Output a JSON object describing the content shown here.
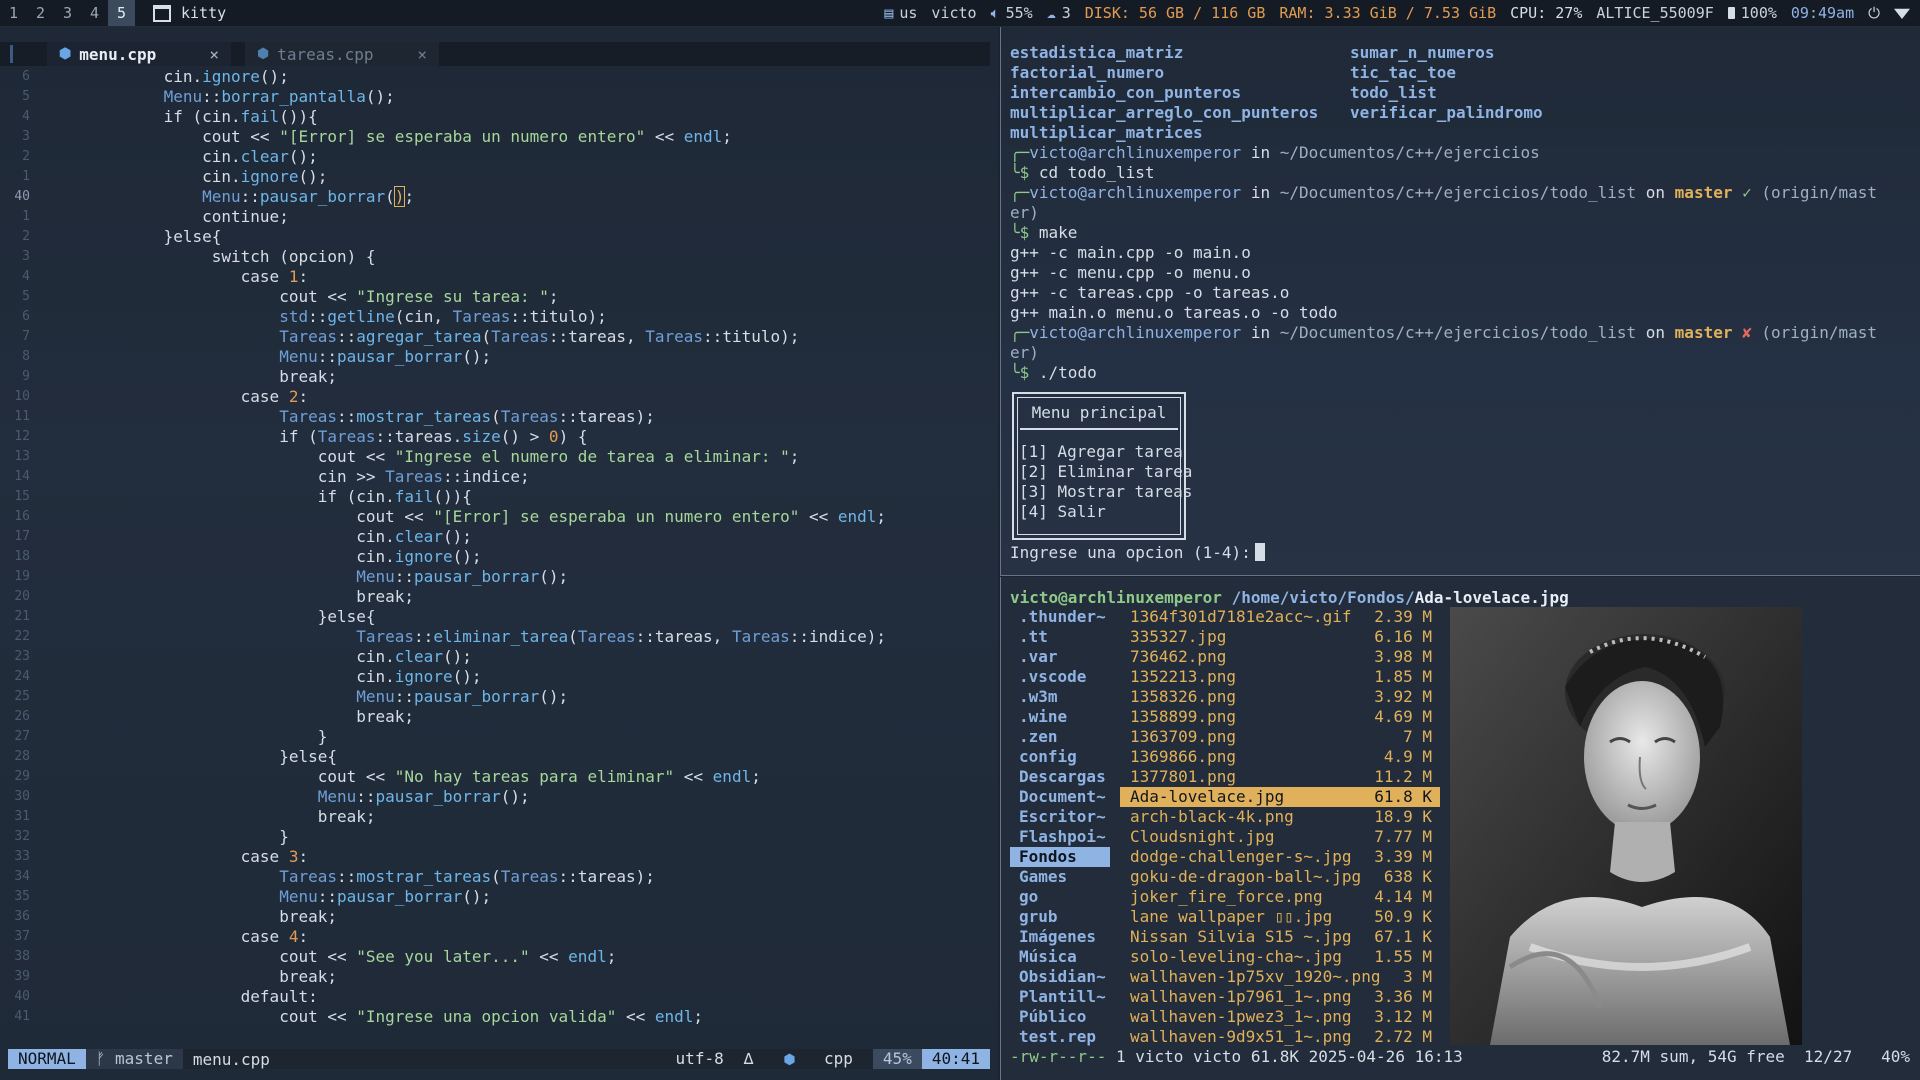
{
  "topbar": {
    "workspaces": [
      "1",
      "2",
      "3",
      "4",
      "5"
    ],
    "active_workspace": "5",
    "window_title": "kitty",
    "keyboard": "us",
    "user": "victo",
    "volume": "55%",
    "updates": "3",
    "disk": "DISK: 56 GB / 116 GB",
    "ram": "RAM: 3.33 GiB / 7.53 GiB",
    "cpu": "CPU: 27%",
    "network": "ALTICE_55009F",
    "battery": "100%",
    "time": "09:49am"
  },
  "editor": {
    "tabs": [
      {
        "label": "menu.cpp",
        "close": "×"
      },
      {
        "label": "tareas.cpp",
        "close": "×"
      }
    ],
    "statusline": {
      "mode": "NORMAL",
      "branch": "master",
      "file": "menu.cpp",
      "encoding": "utf-8",
      "delta": "∆",
      "filetype": "cpp",
      "percent": "45%",
      "position": "40:41"
    },
    "line_numbers": [
      "6",
      "5",
      "4",
      "3",
      "2",
      "1",
      "40",
      "1",
      "2",
      "3",
      "4",
      "5",
      "6",
      "7",
      "8",
      "9",
      "10",
      "11",
      "12",
      "13",
      "14",
      "15",
      "16",
      "17",
      "18",
      "19",
      "20",
      "21",
      "22",
      "23",
      "24",
      "25",
      "26",
      "27",
      "28",
      "29",
      "30",
      "31",
      "32",
      "33",
      "34",
      "35",
      "36",
      "37",
      "38",
      "39",
      "40",
      "41"
    ]
  },
  "terminal": {
    "ls_col1": [
      "estadistica_matriz",
      "factorial_numero",
      "intercambio_con_punteros",
      "multiplicar_arreglo_con_punteros",
      "multiplicar_matrices"
    ],
    "ls_col2": [
      "sumar_n_numeros",
      "tic_tac_toe",
      "todo_list",
      "verificar_palindromo"
    ],
    "prompt1_user": "victo@archlinuxemperor",
    "prompt1_in": " in ",
    "prompt1_path": "~/Documentos/c++/ejercicios",
    "cmd1": "cd todo_list",
    "prompt2_path": "~/Documentos/c++/ejercicios/todo_list",
    "on": " on ",
    "branch": "master",
    "ok_mark": "✓",
    "bad_mark": "✘",
    "origin_a": "(origin/mast",
    "origin_b": "er)",
    "cmd2": "make",
    "make_out": [
      "g++ -c main.cpp -o main.o",
      "g++ -c menu.cpp -o menu.o",
      "g++ -c tareas.cpp -o tareas.o",
      "g++ main.o menu.o tareas.o -o todo"
    ],
    "cmd3": "./todo",
    "menu_title": "Menu principal",
    "menu_items": [
      "[1] Agregar tarea",
      "[2] Eliminar tarea",
      "[3] Mostrar tareas",
      "[4] Salir"
    ],
    "input_prompt": "Ingrese una opcion (1-4):"
  },
  "file_manager": {
    "header_user": "victo@archlinuxemperor",
    "header_path": "/home/victo/Fondos/",
    "header_file": "Ada-lovelace.jpg",
    "dirs": [
      ".thunder~",
      ".tt",
      ".var",
      ".vscode",
      ".w3m",
      ".wine",
      ".zen",
      "config",
      "Descargas",
      "Document~",
      "Escritor~",
      "Flashpoi~",
      "Fondos",
      "Games",
      "go",
      "grub",
      "Imágenes",
      "Música",
      "Obsidian~",
      "Plantill~",
      "Público",
      "test.rep"
    ],
    "selected_dir": "Fondos",
    "files": [
      {
        "name": "1364f301d7181e2acc~.gif",
        "size": "2.39 M"
      },
      {
        "name": "335327.jpg",
        "size": "6.16 M"
      },
      {
        "name": "736462.png",
        "size": "3.98 M"
      },
      {
        "name": "1352213.png",
        "size": "1.85 M"
      },
      {
        "name": "1358326.png",
        "size": "3.92 M"
      },
      {
        "name": "1358899.png",
        "size": "4.69 M"
      },
      {
        "name": "1363709.png",
        "size": "7 M"
      },
      {
        "name": "1369866.png",
        "size": "4.9 M"
      },
      {
        "name": "1377801.png",
        "size": "11.2 M"
      },
      {
        "name": "Ada-lovelace.jpg",
        "size": "61.8 K"
      },
      {
        "name": "arch-black-4k.png",
        "size": "18.9 K"
      },
      {
        "name": "Cloudsnight.jpg",
        "size": "7.77 M"
      },
      {
        "name": "dodge-challenger-s~.jpg",
        "size": "3.39 M"
      },
      {
        "name": "goku-de-dragon-ball~.jpg",
        "size": "638 K"
      },
      {
        "name": "joker_fire_force.png",
        "size": "4.14 M"
      },
      {
        "name": "lane wallpaper ▯▯.jpg",
        "size": "50.9 K"
      },
      {
        "name": "Nissan Silvia S15 ~.jpg",
        "size": "67.1 K"
      },
      {
        "name": "solo-leveling-cha~.jpg",
        "size": "1.55 M"
      },
      {
        "name": "wallhaven-1p75xv_1920~.png",
        "size": "3 M"
      },
      {
        "name": "wallhaven-1p7961_1~.png",
        "size": "3.36 M"
      },
      {
        "name": "wallhaven-1pwez3_1~.png",
        "size": "3.12 M"
      },
      {
        "name": "wallhaven-9d9x51_1~.png",
        "size": "2.72 M"
      }
    ],
    "selected_file": "Ada-lovelace.jpg",
    "footer_perm": "-rw-r--r--",
    "footer_info": " 1 victo victo 61.8K 2025-04-26 16:13",
    "footer_right": "82.7M sum, 54G free  12/27   40%"
  },
  "colors": {
    "accent": "#8fb3e3",
    "string": "#a7d79a",
    "function": "#6fb6e8",
    "number": "#e39b52",
    "selection_file": "#e0b15a"
  }
}
